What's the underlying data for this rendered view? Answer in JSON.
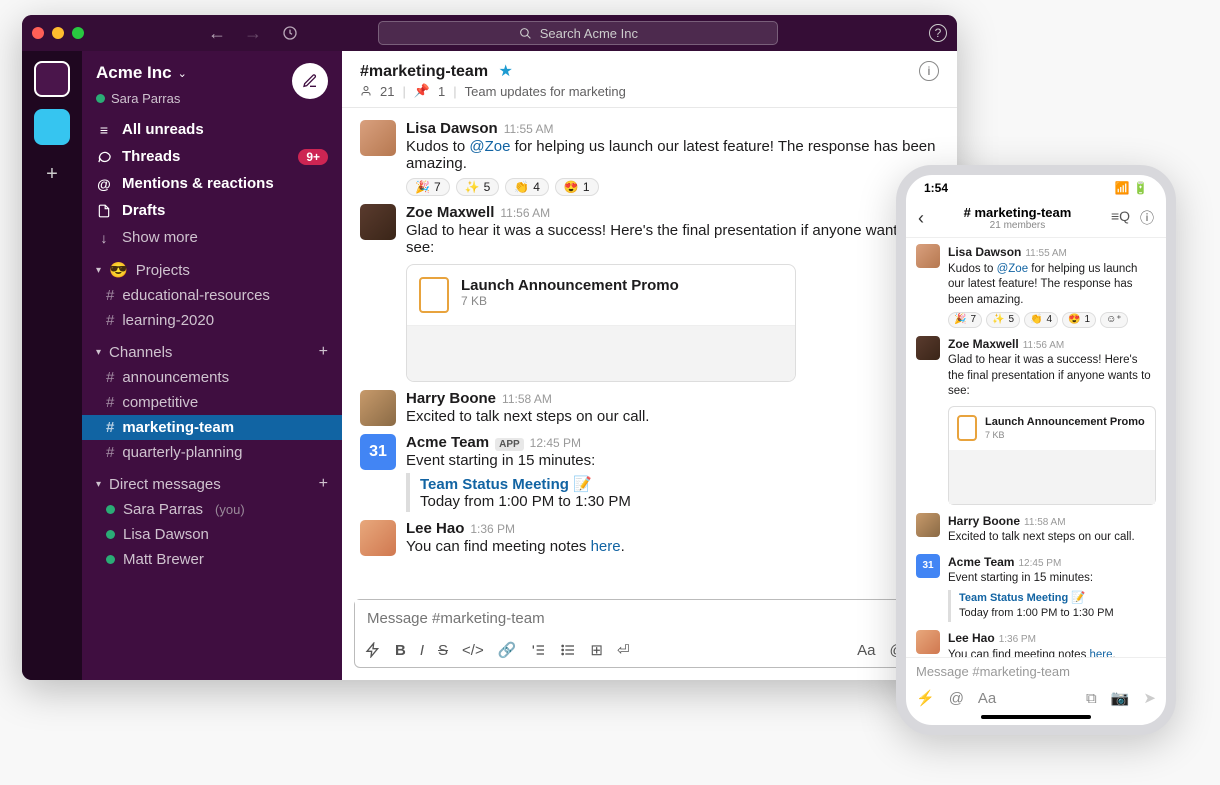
{
  "titlebar": {
    "search_placeholder": "Search Acme Inc"
  },
  "workspace": {
    "name": "Acme Inc",
    "user": "Sara Parras"
  },
  "nav": {
    "unreads": "All unreads",
    "threads": "Threads",
    "threads_badge": "9+",
    "mentions": "Mentions & reactions",
    "drafts": "Drafts",
    "show_more": "Show more"
  },
  "sections": {
    "projects": {
      "label": "Projects",
      "emoji": "😎",
      "items": [
        "educational-resources",
        "learning-2020"
      ]
    },
    "channels": {
      "label": "Channels",
      "items": [
        "announcements",
        "competitive",
        "marketing-team",
        "quarterly-planning"
      ],
      "active": "marketing-team"
    },
    "dms": {
      "label": "Direct messages",
      "items": [
        {
          "name": "Sara Parras",
          "you": true
        },
        {
          "name": "Lisa Dawson",
          "you": false
        },
        {
          "name": "Matt Brewer",
          "you": false
        }
      ]
    }
  },
  "channel": {
    "name": "#marketing-team",
    "starred": true,
    "members": "21",
    "pinned": "1",
    "topic": "Team updates for marketing"
  },
  "messages": [
    {
      "sender": "Lisa Dawson",
      "time": "11:55 AM",
      "body_pre": "Kudos to ",
      "mention": "@Zoe",
      "body_post": " for helping us launch our latest feature! The response has been amazing.",
      "reactions": [
        {
          "e": "🎉",
          "c": "7"
        },
        {
          "e": "✨",
          "c": "5"
        },
        {
          "e": "👏",
          "c": "4"
        },
        {
          "e": "😍",
          "c": "1"
        }
      ]
    },
    {
      "sender": "Zoe Maxwell",
      "time": "11:56 AM",
      "body": "Glad to hear it was a success! Here's the final presentation if anyone wants to see:",
      "file": {
        "name": "Launch Announcement Promo",
        "size": "7 KB"
      }
    },
    {
      "sender": "Harry Boone",
      "time": "11:58 AM",
      "body": "Excited to talk next steps on our call."
    },
    {
      "sender": "Acme Team",
      "app": true,
      "time": "12:45 PM",
      "body": "Event starting in 15 minutes:",
      "event": {
        "title": "Team Status Meeting",
        "emoji": "📝",
        "when": "Today from 1:00 PM to 1:30 PM"
      }
    },
    {
      "sender": "Lee Hao",
      "time": "1:36 PM",
      "body_pre": "You can find meeting notes ",
      "link": "here",
      "body_post": "."
    }
  ],
  "composer": {
    "placeholder": "Message #marketing-team"
  },
  "mobile": {
    "time": "1:54",
    "channel": "# marketing-team",
    "members": "21 members",
    "composer_placeholder": "Message #marketing-team"
  }
}
